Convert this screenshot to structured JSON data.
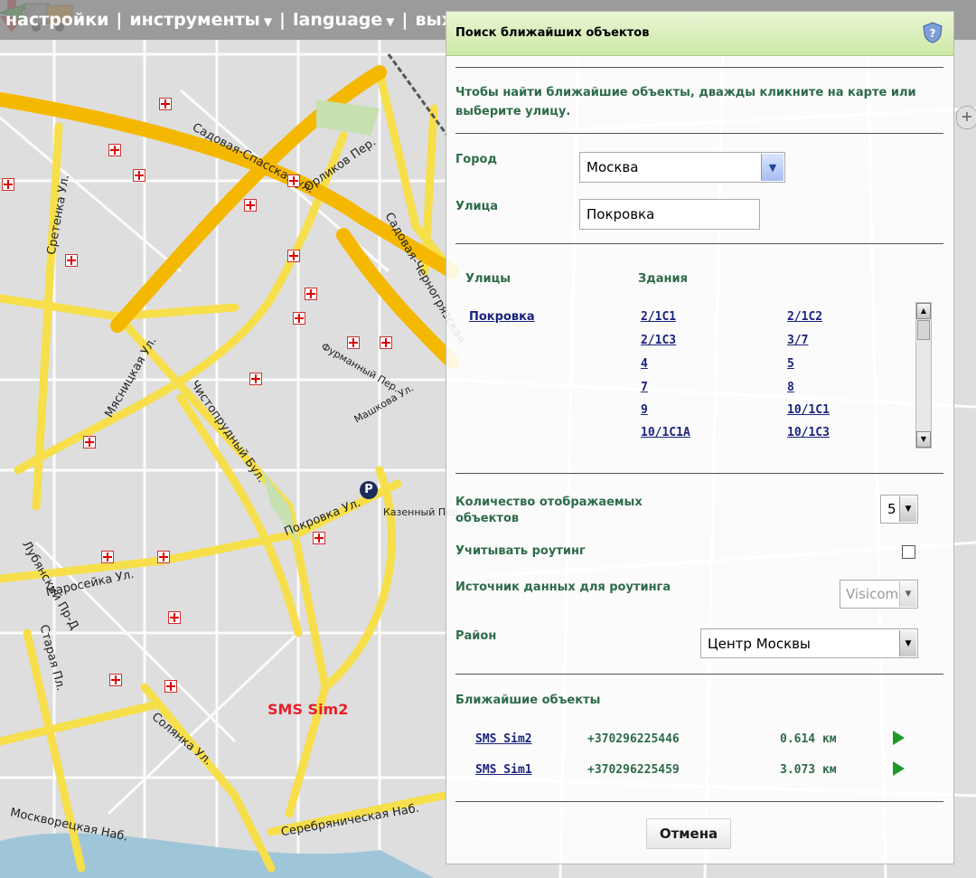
{
  "topbar": {
    "items": [
      "настройки",
      "инструменты",
      "language",
      "выход"
    ]
  },
  "map": {
    "streets": [
      "Садовая-Спасская ул.",
      "Орликов Пер.",
      "Сретенка Ул.",
      "Мясницкая Ул.",
      "Чистопрудный Бул.",
      "Покровка Ул.",
      "Маросейка Ул.",
      "Солянка Ул.",
      "Москворецкая Наб.",
      "Серебряническая Наб.",
      "Старая Пл.",
      "Лубянский Пр-Д",
      "Садовая-Черногрязская",
      "Казенный Пер.",
      "Фурманный Пер.",
      "Машкова Ул."
    ],
    "marker_label": "SMS Sim2",
    "parking_symbol": "P",
    "road_color": "#f6df4a",
    "major_road_color": "#f5b800"
  },
  "panel": {
    "title": "Поиск ближайших объектов",
    "instructions": "Чтобы найти ближайшие объекты, дважды кликните на карте или выберите улицу.",
    "city_label": "Город",
    "city_value": "Москва",
    "street_label": "Улица",
    "street_value": "Покровка",
    "streets_header": "Улицы",
    "buildings_header": "Здания",
    "street_result": "Покровка",
    "buildings": [
      "2/1С1",
      "2/1С2",
      "2/1С3",
      "3/7",
      "4",
      "5",
      "7",
      "8",
      "9",
      "10/1С1",
      "10/1С1А",
      "10/1С3"
    ],
    "count_label": "Количество отображаемых объектов",
    "count_value": "5",
    "routing_label": "Учитывать роутинг",
    "routing_checked": false,
    "source_label": "Источник данных для роутинга",
    "source_value": "Visicom",
    "district_label": "Район",
    "district_value": "Центр Москвы",
    "nearest_label": "Ближайшие объекты",
    "nearest": [
      {
        "name": "SMS Sim2",
        "phone": "+370296225446",
        "distance": "0.614 км"
      },
      {
        "name": "SMS Sim1",
        "phone": "+370296225459",
        "distance": "3.073 км"
      }
    ],
    "cancel_label": "Отмена",
    "accent_color": "#2e6b4a",
    "link_color": "#1a237e"
  }
}
